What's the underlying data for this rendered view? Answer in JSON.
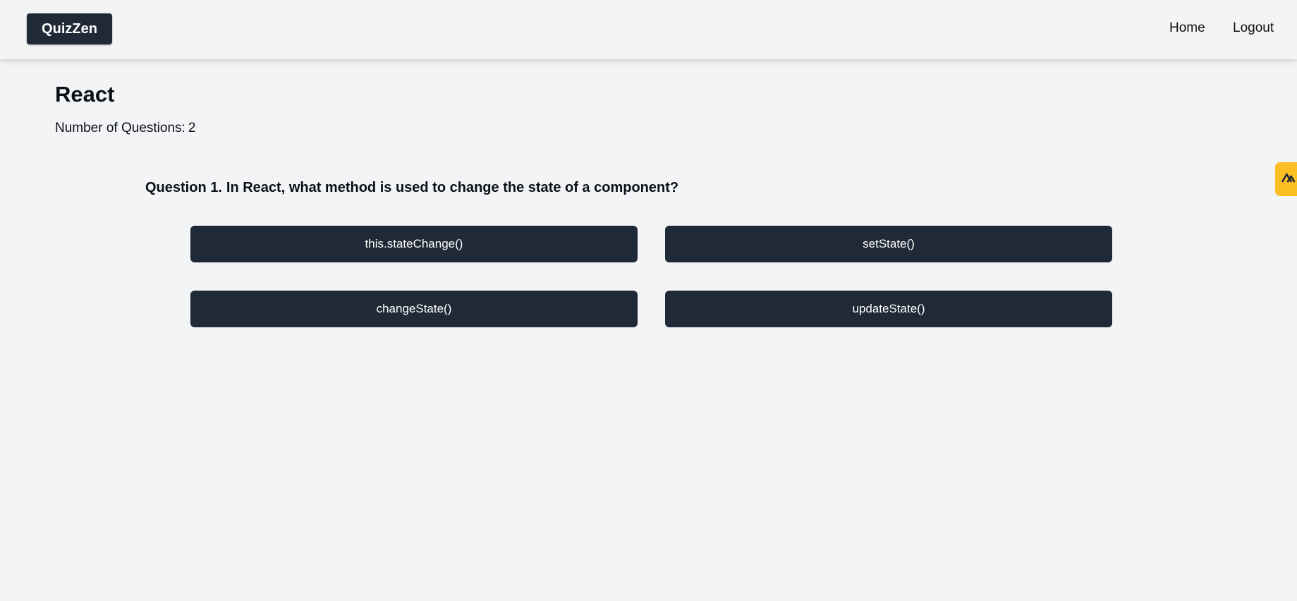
{
  "navbar": {
    "logo": "QuizZen",
    "links": [
      "Home",
      "Logout"
    ]
  },
  "quiz": {
    "title": "React",
    "count_label": "Number of Questions:",
    "count_value": "2"
  },
  "question": {
    "prefix": "Question 1.",
    "text": "In React, what method is used to change the state of a component?",
    "answers": [
      "this.stateChange()",
      "setState()",
      "changeState()",
      "updateState()"
    ]
  },
  "side_widget": {
    "icon": "double-chevron-up-icon",
    "color": "#fbbf24"
  },
  "colors": {
    "background": "#f3f4f6",
    "button": "#1f2937",
    "button_text": "#ffffff"
  }
}
